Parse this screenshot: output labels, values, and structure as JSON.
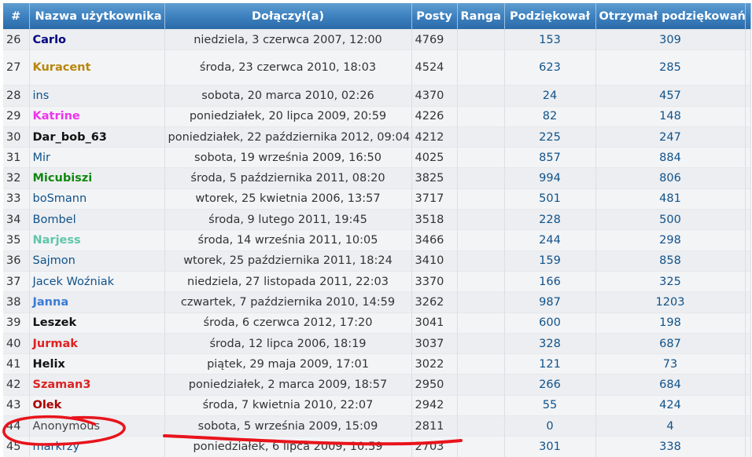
{
  "headers": {
    "rank": "#",
    "username": "Nazwa użytkownika",
    "joined": "Dołączył(a)",
    "posts": "Posty",
    "rank_title": "Ranga",
    "thanks_given": "Podziękował",
    "thanks_received": "Otrzymał podziękowań"
  },
  "colors": {
    "header_bg": "#4084c2",
    "link_default": "#105289",
    "annotation": "#e8141c"
  },
  "rows": [
    {
      "rank": "26",
      "name": "Carlo",
      "color": "#000080",
      "bold": true,
      "joined": "niedziela, 3 czerwca 2007, 12:00",
      "posts": "4769",
      "rank_title": "",
      "given": "153",
      "received": "309",
      "tall": false
    },
    {
      "rank": "27",
      "name": "Kuracent",
      "color": "#b8860b",
      "bold": true,
      "joined": "środa, 23 czerwca 2010, 18:03",
      "posts": "4524",
      "rank_title": "",
      "given": "623",
      "received": "285",
      "tall": true
    },
    {
      "rank": "28",
      "name": "ins",
      "color": "#105289",
      "bold": false,
      "joined": "sobota, 20 marca 2010, 02:26",
      "posts": "4370",
      "rank_title": "",
      "given": "24",
      "received": "457",
      "tall": false
    },
    {
      "rank": "29",
      "name": "Katrine",
      "color": "#ee33ee",
      "bold": true,
      "joined": "poniedziałek, 20 lipca 2009, 20:59",
      "posts": "4226",
      "rank_title": "",
      "given": "82",
      "received": "148",
      "tall": false
    },
    {
      "rank": "30",
      "name": "Dar_bob_63",
      "color": "#111111",
      "bold": true,
      "joined": "poniedziałek, 22 października 2012, 09:04",
      "posts": "4212",
      "rank_title": "",
      "given": "225",
      "received": "247",
      "tall": false
    },
    {
      "rank": "31",
      "name": "Mir",
      "color": "#105289",
      "bold": false,
      "joined": "sobota, 19 września 2009, 16:50",
      "posts": "4025",
      "rank_title": "",
      "given": "857",
      "received": "884",
      "tall": false
    },
    {
      "rank": "32",
      "name": "Micubiszi",
      "color": "#118811",
      "bold": true,
      "joined": "środa, 5 października 2011, 08:20",
      "posts": "3825",
      "rank_title": "",
      "given": "994",
      "received": "806",
      "tall": false
    },
    {
      "rank": "33",
      "name": "boSmann",
      "color": "#105289",
      "bold": false,
      "joined": "wtorek, 25 kwietnia 2006, 13:57",
      "posts": "3717",
      "rank_title": "",
      "given": "501",
      "received": "481",
      "tall": false
    },
    {
      "rank": "34",
      "name": "Bombel",
      "color": "#105289",
      "bold": false,
      "joined": "środa, 9 lutego 2011, 19:45",
      "posts": "3518",
      "rank_title": "",
      "given": "228",
      "received": "500",
      "tall": false
    },
    {
      "rank": "35",
      "name": "Narjess",
      "color": "#5fc6a8",
      "bold": true,
      "joined": "środa, 14 września 2011, 10:05",
      "posts": "3466",
      "rank_title": "",
      "given": "244",
      "received": "298",
      "tall": false
    },
    {
      "rank": "36",
      "name": "Sajmon",
      "color": "#105289",
      "bold": false,
      "joined": "wtorek, 25 października 2011, 18:24",
      "posts": "3410",
      "rank_title": "",
      "given": "159",
      "received": "858",
      "tall": false
    },
    {
      "rank": "37",
      "name": "Jacek Woźniak",
      "color": "#105289",
      "bold": false,
      "joined": "niedziela, 27 listopada 2011, 22:03",
      "posts": "3370",
      "rank_title": "",
      "given": "166",
      "received": "325",
      "tall": false
    },
    {
      "rank": "38",
      "name": "Janna",
      "color": "#3a7bd5",
      "bold": true,
      "joined": "czwartek, 7 października 2010, 14:59",
      "posts": "3262",
      "rank_title": "",
      "given": "987",
      "received": "1203",
      "tall": false
    },
    {
      "rank": "39",
      "name": "Leszek",
      "color": "#111111",
      "bold": true,
      "joined": "środa, 6 czerwca 2012, 17:20",
      "posts": "3041",
      "rank_title": "",
      "given": "600",
      "received": "198",
      "tall": false
    },
    {
      "rank": "40",
      "name": "Jurmak",
      "color": "#dd2222",
      "bold": true,
      "joined": "środa, 12 lipca 2006, 18:19",
      "posts": "3037",
      "rank_title": "",
      "given": "328",
      "received": "687",
      "tall": false
    },
    {
      "rank": "41",
      "name": "Helix",
      "color": "#111111",
      "bold": true,
      "joined": "piątek, 29 maja 2009, 17:01",
      "posts": "3022",
      "rank_title": "",
      "given": "121",
      "received": "73",
      "tall": false
    },
    {
      "rank": "42",
      "name": "Szaman3",
      "color": "#dd2222",
      "bold": true,
      "joined": "poniedziałek, 2 marca 2009, 18:57",
      "posts": "2950",
      "rank_title": "",
      "given": "266",
      "received": "684",
      "tall": false
    },
    {
      "rank": "43",
      "name": "Olek",
      "color": "#aa0000",
      "bold": true,
      "joined": "środa, 7 kwietnia 2010, 22:07",
      "posts": "2942",
      "rank_title": "",
      "given": "55",
      "received": "424",
      "tall": false
    },
    {
      "rank": "44",
      "name": "Anonymous",
      "color": "#444444",
      "bold": false,
      "joined": "sobota, 5 września 2009, 15:09",
      "posts": "2811",
      "rank_title": "",
      "given": "0",
      "received": "4",
      "tall": false
    },
    {
      "rank": "45",
      "name": "markrzy",
      "color": "#105289",
      "bold": false,
      "joined": "poniedziałek, 6 lipca 2009, 10:59",
      "posts": "2703",
      "rank_title": "",
      "given": "301",
      "received": "338",
      "tall": false
    }
  ]
}
